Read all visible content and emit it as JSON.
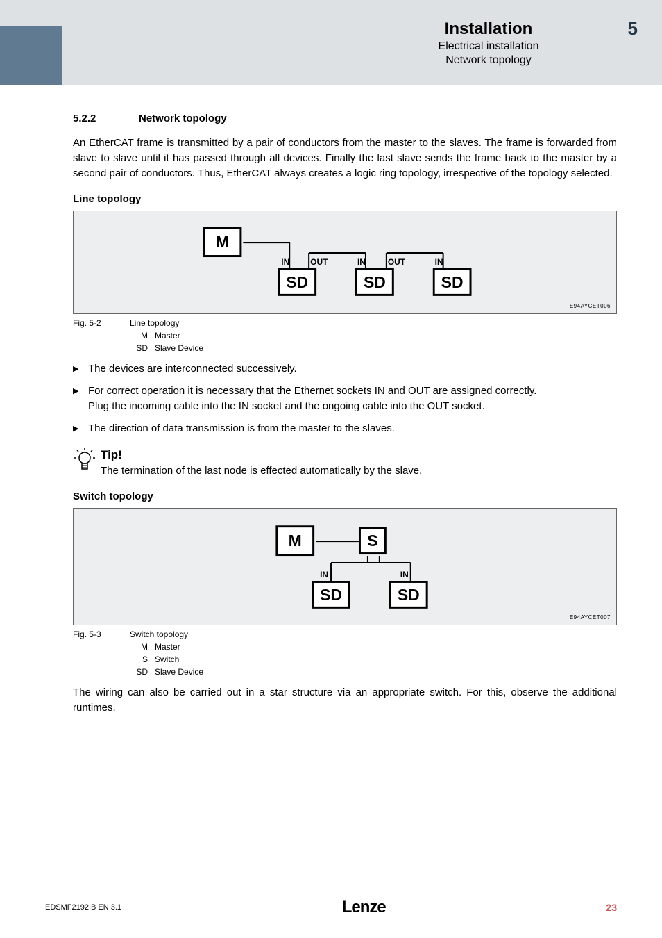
{
  "header": {
    "title": "Installation",
    "sub1": "Electrical installation",
    "sub2": "Network topology",
    "chapter": "5"
  },
  "section": {
    "num": "5.2.2",
    "title": "Network topology",
    "intro": "An EtherCAT frame is transmitted by a pair of conductors from the master to the slaves. The frame is forwarded from slave to slave until it has passed through all devices. Finally the last slave sends the frame back to the master by a second pair of conductors. Thus, EtherCAT always creates a logic ring topology, irrespective of the topology selected."
  },
  "line": {
    "heading": "Line topology",
    "diag": {
      "M": "M",
      "SD": "SD",
      "IN": "IN",
      "OUT": "OUT",
      "code": "E94AYCET006"
    },
    "fig_label": "Fig. 5-2",
    "fig_caption": "Line topology",
    "legend": [
      {
        "k": "M",
        "v": "Master"
      },
      {
        "k": "SD",
        "v": "Slave Device"
      }
    ],
    "bullets": [
      "The devices are interconnected successively.",
      "For correct operation it is necessary that the Ethernet sockets IN and OUT are assigned correctly.\nPlug the incoming cable into the IN socket and the ongoing cable into the OUT socket.",
      "The direction of data transmission is from the master to the slaves."
    ]
  },
  "tip": {
    "title": "Tip!",
    "text": "The termination of the last node is effected automatically by the slave."
  },
  "switch": {
    "heading": "Switch topology",
    "diag": {
      "M": "M",
      "S": "S",
      "SD": "SD",
      "IN": "IN",
      "code": "E94AYCET007"
    },
    "fig_label": "Fig. 5-3",
    "fig_caption": "Switch topology",
    "legend": [
      {
        "k": "M",
        "v": "Master"
      },
      {
        "k": "S",
        "v": "Switch"
      },
      {
        "k": "SD",
        "v": "Slave Device"
      }
    ],
    "closing": "The wiring can also be carried out in a star structure via an appropriate switch. For this, observe the additional runtimes."
  },
  "footer": {
    "left": "EDSMF2192IB  EN  3.1",
    "logo": "Lenze",
    "page": "23"
  }
}
